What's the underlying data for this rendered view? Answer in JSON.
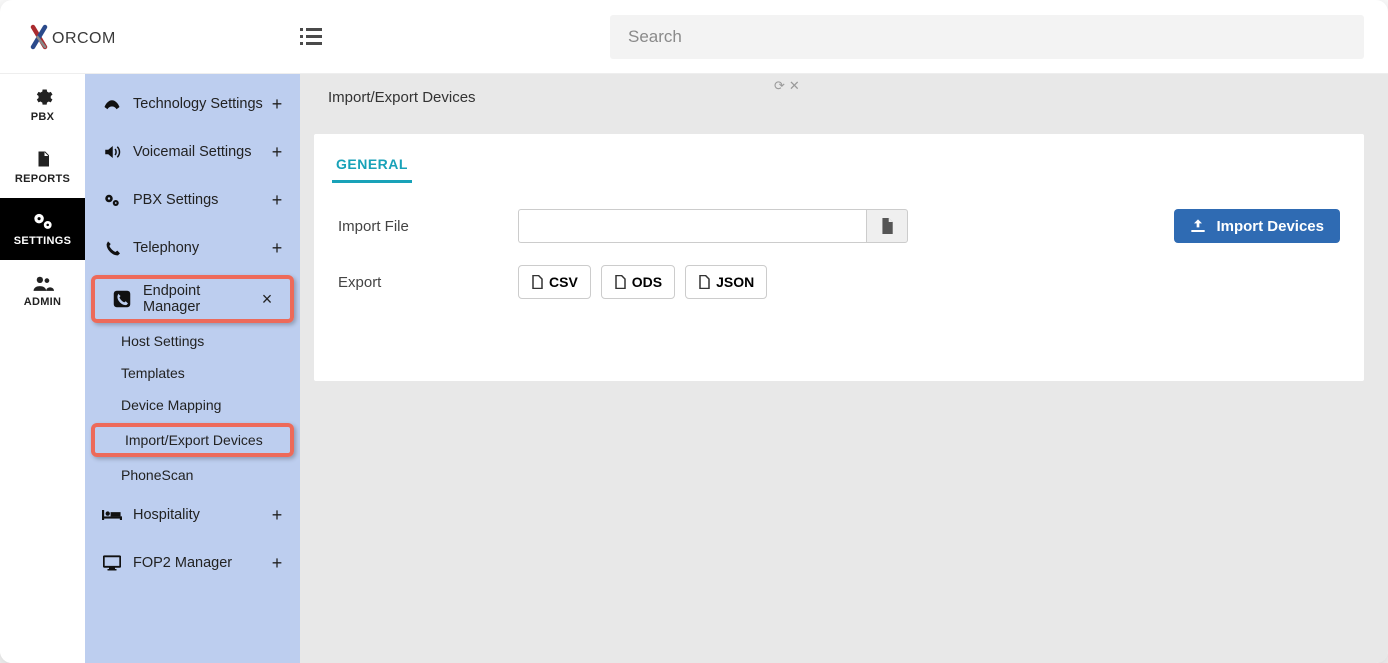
{
  "brand": {
    "name": "XORCOM"
  },
  "search": {
    "placeholder": "Search"
  },
  "rail": {
    "items": [
      {
        "label": "PBX"
      },
      {
        "label": "REPORTS"
      },
      {
        "label": "SETTINGS"
      },
      {
        "label": "ADMIN"
      }
    ]
  },
  "sidebar": {
    "items": [
      {
        "label": "Technology Settings",
        "action": "+"
      },
      {
        "label": "Voicemail Settings",
        "action": "+"
      },
      {
        "label": "PBX Settings",
        "action": "+"
      },
      {
        "label": "Telephony",
        "action": "+"
      },
      {
        "label": "Endpoint Manager",
        "action": "×"
      },
      {
        "label": "Hospitality",
        "action": "+"
      },
      {
        "label": "FOP2 Manager",
        "action": "+"
      }
    ],
    "endpoint_sub": [
      "Host Settings",
      "Templates",
      "Device Mapping",
      "Import/Export Devices",
      "PhoneScan"
    ]
  },
  "page": {
    "tab_label": "Import/Export Devices",
    "inner_tab": "GENERAL",
    "import_label": "Import File",
    "export_label": "Export",
    "export_buttons": {
      "csv": "CSV",
      "ods": "ODS",
      "json": "JSON"
    },
    "import_button": "Import Devices"
  }
}
